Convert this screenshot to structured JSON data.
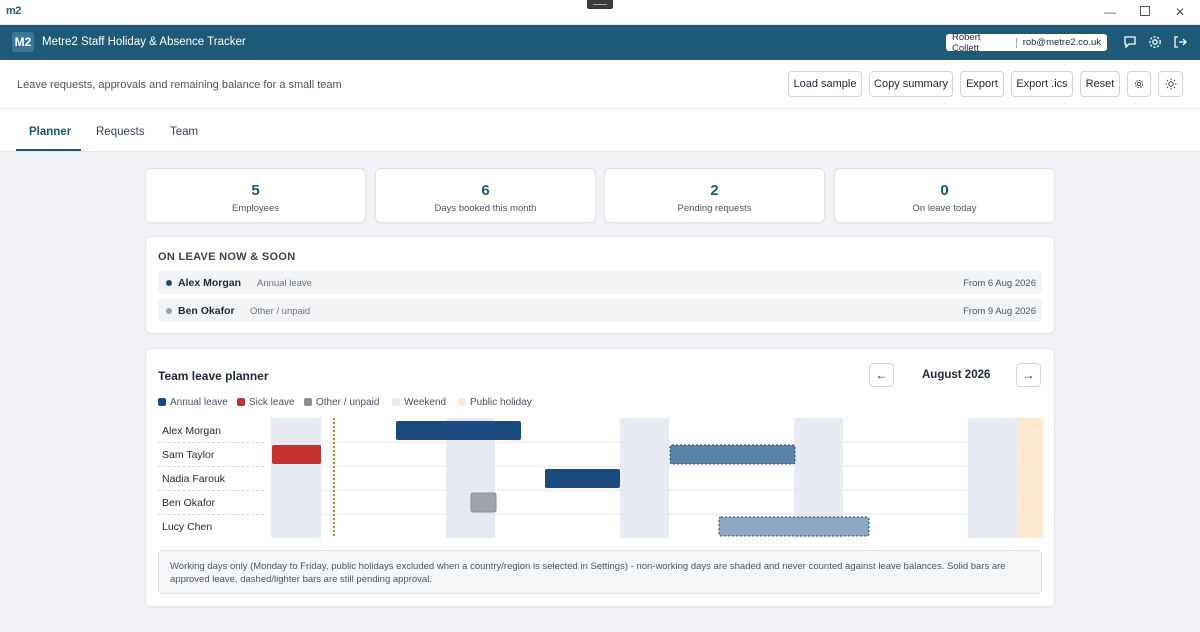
{
  "window": {
    "logo": "m2"
  },
  "header": {
    "logo": "M2",
    "title": "Metre2 Staff Holiday & Absence Tracker",
    "user_name": "Robert Collett",
    "user_email": "rob@metre2.co.uk"
  },
  "toolbar": {
    "subtitle": "Leave requests, approvals and remaining balance for a small team",
    "buttons": [
      "Load sample",
      "Copy summary",
      "Export",
      "Export .ics",
      "Reset"
    ]
  },
  "tabs": [
    "Planner",
    "Requests",
    "Team"
  ],
  "stats": [
    {
      "value": "5",
      "label": "Employees"
    },
    {
      "value": "6",
      "label": "Days booked this month"
    },
    {
      "value": "2",
      "label": "Pending requests"
    },
    {
      "value": "0",
      "label": "On leave today"
    }
  ],
  "on_leave": {
    "title": "ON LEAVE NOW & SOON",
    "rows": [
      {
        "name": "Alex Morgan",
        "type": "Annual leave",
        "date": "From 6 Aug 2026",
        "color": "#1a4a80"
      },
      {
        "name": "Ben Okafor",
        "type": "Other / unpaid",
        "date": "From 9 Aug 2026",
        "color": "#9ca3af"
      }
    ]
  },
  "planner": {
    "title": "Team leave planner",
    "month": "August 2026",
    "prev": "←",
    "next": "→",
    "legend": [
      {
        "label": "Annual leave",
        "color": "#1a4a80"
      },
      {
        "label": "Sick leave",
        "color": "#c53030"
      },
      {
        "label": "Other / unpaid",
        "color": "#8a8f98"
      },
      {
        "label": "Weekend",
        "color": "#e6eaf2"
      },
      {
        "label": "Public holiday",
        "color": "#fde9cf"
      }
    ],
    "employees": [
      "Alex Morgan",
      "Sam Taylor",
      "Nadia Farouk",
      "Ben Okafor",
      "Lucy Chen"
    ],
    "note": "Working days only (Monday to Friday, public holidays excluded when a country/region is selected in Settings) - non-working days are shaded and never counted against leave balances. Solid bars are approved leave, dashed/lighter bars are still pending approval."
  }
}
